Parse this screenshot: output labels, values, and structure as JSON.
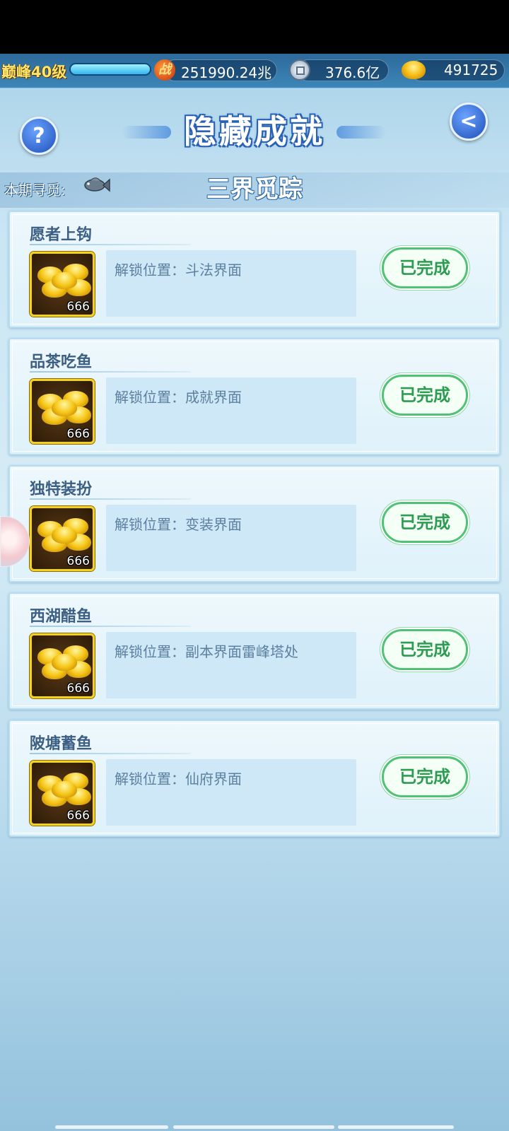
{
  "topbar": {
    "level_label": "巅峰40级",
    "exp_fraction": 1.0,
    "battle_power": "251990.24兆",
    "coins": "376.6亿",
    "ingots": "491725",
    "icons": [
      "battle-power-icon",
      "copper-coin-icon",
      "gold-ingot-icon"
    ]
  },
  "header": {
    "title": "隐藏成就",
    "help_icon": "question-mark-icon",
    "back_icon": "back-arrow-icon"
  },
  "seek": {
    "label": "本期寻觅:",
    "realm": "三界觅踪"
  },
  "achievements": [
    {
      "name": "愿者上钩",
      "reward_count": "666",
      "desc": "解锁位置：斗法界面",
      "status": "已完成"
    },
    {
      "name": "品茶吃鱼",
      "reward_count": "666",
      "desc": "解锁位置：成就界面",
      "status": "已完成"
    },
    {
      "name": "独特装扮",
      "reward_count": "666",
      "desc": "解锁位置：变装界面",
      "status": "已完成"
    },
    {
      "name": "西湖醋鱼",
      "reward_count": "666",
      "desc": "解锁位置：副本界面雷峰塔处",
      "status": "已完成"
    },
    {
      "name": "陂塘蓄鱼",
      "reward_count": "666",
      "desc": "解锁位置：仙府界面",
      "status": "已完成"
    }
  ],
  "colors": {
    "title_outline": "#2a62b4",
    "done_green": "#2e9b53",
    "gold": "#f6c617"
  }
}
